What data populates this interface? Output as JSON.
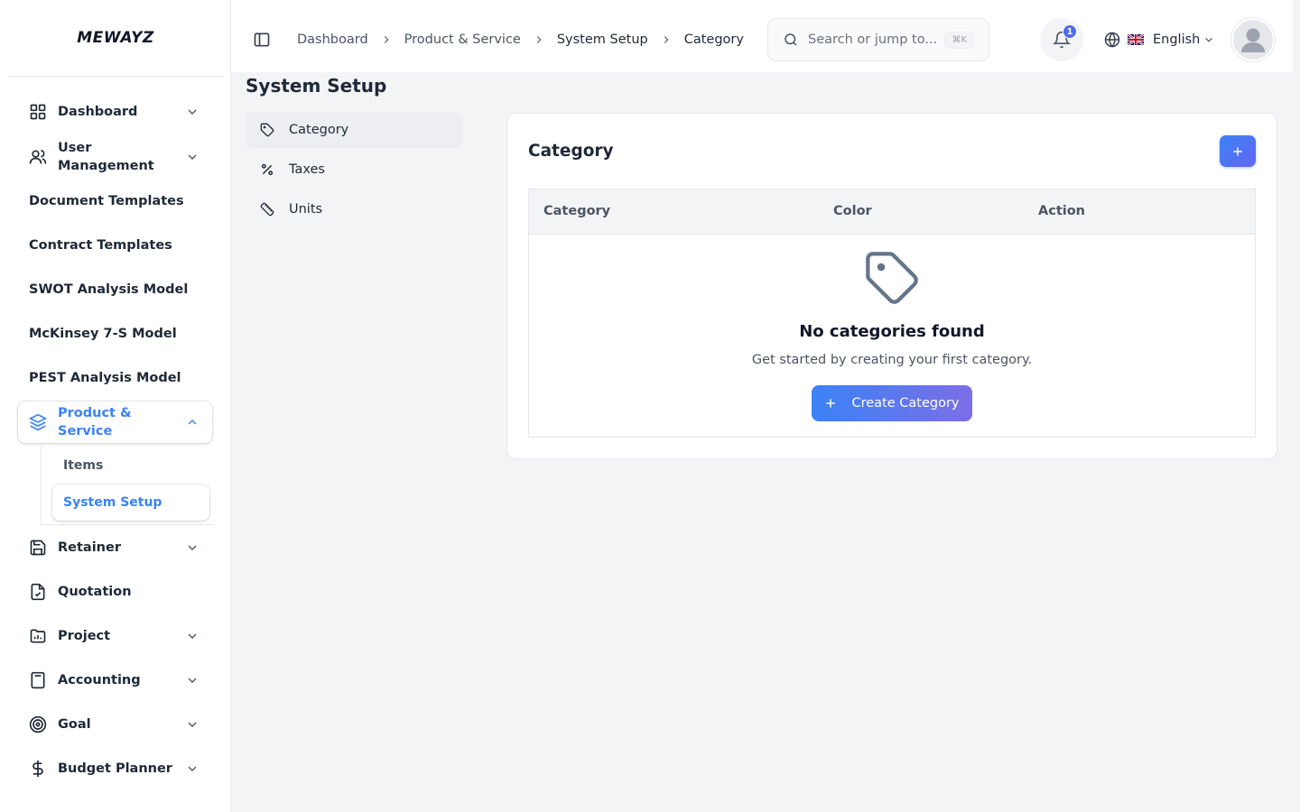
{
  "brand": {
    "logo_text": "MEWAYZ"
  },
  "sidebar": {
    "items": [
      {
        "label": "Dashboard",
        "icon": "grid-icon"
      },
      {
        "label": "User Management",
        "icon": "users-icon"
      },
      {
        "label": "Document Templates"
      },
      {
        "label": "Contract Templates"
      },
      {
        "label": "SWOT Analysis Model"
      },
      {
        "label": "McKinsey 7-S Model"
      },
      {
        "label": "PEST Analysis Model"
      },
      {
        "label": "Product & Service",
        "icon": "layers-icon",
        "expanded": true
      },
      {
        "label": "Retainer",
        "icon": "save-icon"
      },
      {
        "label": "Quotation",
        "icon": "file-check-icon"
      },
      {
        "label": "Project",
        "icon": "folder-chart-icon"
      },
      {
        "label": "Accounting",
        "icon": "calculator-icon"
      },
      {
        "label": "Goal",
        "icon": "target-icon"
      },
      {
        "label": "Budget Planner",
        "icon": "dollar-icon"
      }
    ],
    "submenu": [
      {
        "label": "Items"
      },
      {
        "label": "System Setup",
        "active": true
      }
    ]
  },
  "header": {
    "breadcrumb": [
      "Dashboard",
      "Product & Service",
      "System Setup",
      "Category"
    ],
    "search": {
      "placeholder": "Search or jump to...",
      "shortcut": "⌘K"
    },
    "notifications": {
      "count": "1"
    },
    "language": {
      "label": "English"
    }
  },
  "main": {
    "title": "System Setup",
    "setup_nav": [
      {
        "label": "Category",
        "icon": "tag-icon",
        "active": true
      },
      {
        "label": "Taxes",
        "icon": "percent-icon"
      },
      {
        "label": "Units",
        "icon": "ruler-icon"
      }
    ],
    "card": {
      "title": "Category",
      "columns": [
        "Category",
        "Color",
        "Action"
      ],
      "empty_title": "No categories found",
      "empty_text": "Get started by creating your first category.",
      "create_label": "Create Category"
    }
  },
  "colors": {
    "accent": "#3b82f6",
    "accent_2": "#6366f1",
    "badge": "#4f6bed"
  }
}
